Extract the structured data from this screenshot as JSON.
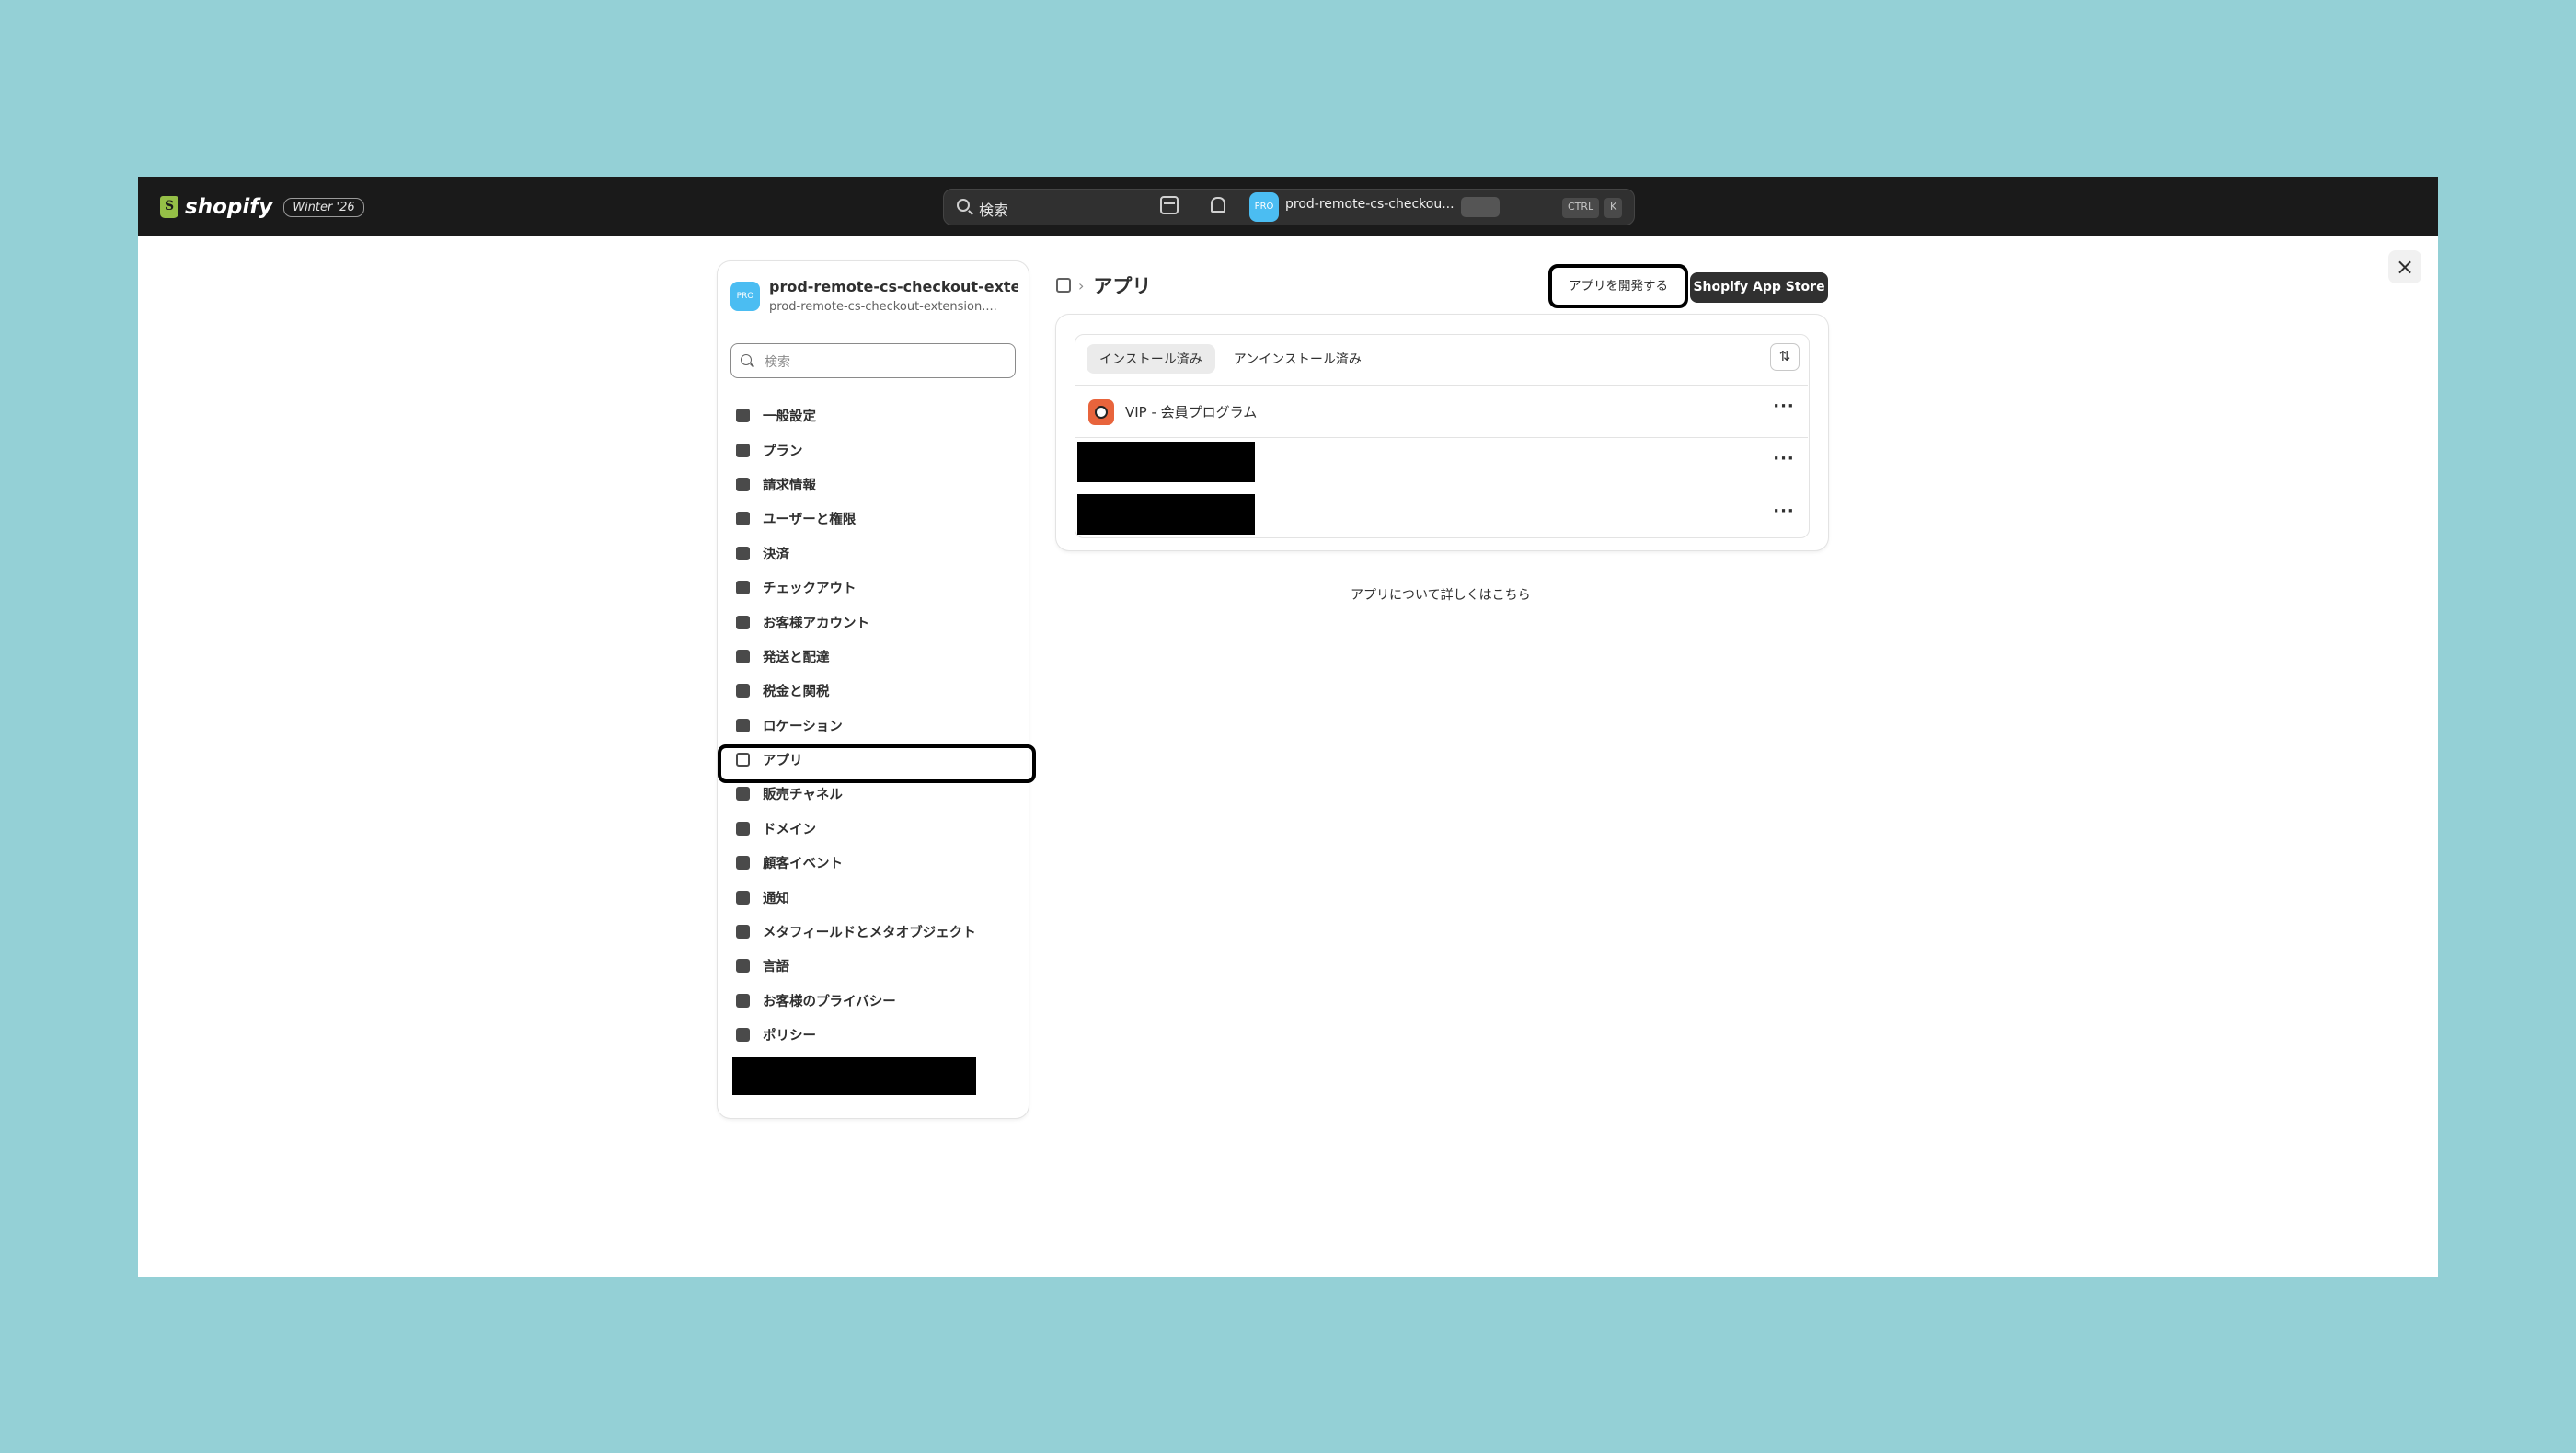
{
  "topbar": {
    "logo_text": "shopify",
    "badge": "Winter '26",
    "search_placeholder": "検索",
    "shortcut_ctrl": "CTRL",
    "shortcut_k": "K",
    "avatar_initials": "PRO",
    "store_name": "prod-remote-cs-checkou..."
  },
  "sidebar": {
    "avatar_initials": "PRO",
    "store_name": "prod-remote-cs-checkout-exte...",
    "store_domain": "prod-remote-cs-checkout-extension....",
    "search_placeholder": "検索",
    "items": [
      {
        "label": "一般設定",
        "icon": "store-icon"
      },
      {
        "label": "プラン",
        "icon": "plan-icon"
      },
      {
        "label": "請求情報",
        "icon": "billing-icon"
      },
      {
        "label": "ユーザーと権限",
        "icon": "users-icon"
      },
      {
        "label": "決済",
        "icon": "payments-icon"
      },
      {
        "label": "チェックアウト",
        "icon": "cart-icon"
      },
      {
        "label": "お客様アカウント",
        "icon": "person-icon"
      },
      {
        "label": "発送と配達",
        "icon": "truck-icon"
      },
      {
        "label": "税金と関税",
        "icon": "tax-icon"
      },
      {
        "label": "ロケーション",
        "icon": "location-icon"
      },
      {
        "label": "アプリ",
        "icon": "apps-icon",
        "active": true
      },
      {
        "label": "販売チャネル",
        "icon": "channels-icon"
      },
      {
        "label": "ドメイン",
        "icon": "domain-icon"
      },
      {
        "label": "顧客イベント",
        "icon": "events-icon"
      },
      {
        "label": "通知",
        "icon": "bell-icon"
      },
      {
        "label": "メタフィールドとメタオブジェクト",
        "icon": "metafields-icon"
      },
      {
        "label": "言語",
        "icon": "language-icon"
      },
      {
        "label": "お客様のプライバシー",
        "icon": "lock-icon"
      },
      {
        "label": "ポリシー",
        "icon": "policy-icon"
      }
    ]
  },
  "main": {
    "breadcrumb_title": "アプリ",
    "develop_button": "アプリを開発する",
    "app_store_button": "Shopify App Store",
    "tabs": [
      {
        "label": "インストール済み",
        "active": true
      },
      {
        "label": "アンインストール済み",
        "active": false
      }
    ],
    "apps": [
      {
        "name": "VIP - 会員プログラム"
      }
    ],
    "learn_more": "アプリについて詳しくはこちら"
  },
  "colors": {
    "background": "#94d0d6",
    "topbar": "#1a1a1a",
    "avatar": "#4bbdf2",
    "primary_button": "#303030"
  }
}
